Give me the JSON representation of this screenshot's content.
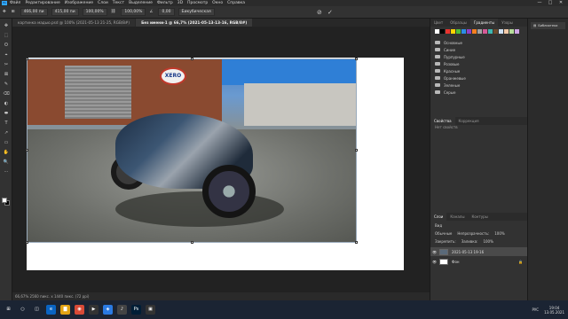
{
  "menubar": {
    "logo": "Ps",
    "items": [
      "Файл",
      "Редактирование",
      "Изображение",
      "Слои",
      "Текст",
      "Выделение",
      "Фильтр",
      "3D",
      "Просмотр",
      "Окно",
      "Справка"
    ],
    "window_controls": [
      "—",
      "□",
      "✕"
    ]
  },
  "options": {
    "x_value": "466,00 пи",
    "y_value": "415,00 пи",
    "w_value": "100,00%",
    "h_value": "100,00%",
    "angle": "0,00",
    "interp": "Бикубическая"
  },
  "tabs": [
    {
      "label": "картинка мадью.psd @ 100% (2021-05-13 21-25, RGB/8#)",
      "active": false
    },
    {
      "label": "Без имени-1 @ 66,7% (2021-05-13-13-16, RGB/8#)",
      "active": true
    }
  ],
  "tools": [
    "✥",
    "⬚",
    "ʘ",
    "⌖",
    "✂",
    "⊠",
    "✎",
    "⌫",
    "◐",
    "⬬",
    "T",
    "↗",
    "▭",
    "✋",
    "🔍",
    "⋯"
  ],
  "canvas": {
    "sign_text": "XERO"
  },
  "statusbar": {
    "text": "66,67%   2560 пикс. x 1440 пикс. (72 ppi)"
  },
  "right_panel": {
    "top_tabs": [
      {
        "label": "Цвет",
        "active": false
      },
      {
        "label": "Образцы",
        "active": false
      },
      {
        "label": "Градиенты",
        "active": true
      },
      {
        "label": "Узоры",
        "active": false
      }
    ],
    "swatch_colors": [
      "#ffffff",
      "#000000",
      "#e8342e",
      "#ffd400",
      "#4dbd38",
      "#2b8ee6",
      "#8f3fc8",
      "#f57f20",
      "#a3a3a3",
      "#d45a96",
      "#3fb7b0",
      "#6d4a2b",
      "#d0e2f5",
      "#f3c9a8",
      "#b6dd9a",
      "#cfa5e5"
    ],
    "folders": [
      "Основные",
      "Синие",
      "Пурпурные",
      "Розовые",
      "Красные",
      "Оранжевые",
      "Зеленые",
      "Серые"
    ],
    "props_tabs": [
      {
        "label": "Свойства",
        "active": true
      },
      {
        "label": "Коррекция",
        "active": false
      }
    ],
    "props_body": "Нет свойств",
    "layers_tabs": [
      {
        "label": "Слои",
        "active": true
      },
      {
        "label": "Каналы",
        "active": false
      },
      {
        "label": "Контуры",
        "active": false
      }
    ],
    "search_label": "Вид",
    "blend_mode": "Обычные",
    "opacity_label": "Непрозрачность:",
    "opacity_value": "100%",
    "lock_label": "Закрепить:",
    "fill_label": "Заливка:",
    "fill_value": "100%",
    "layers": [
      {
        "name": "2021-05-13 19-16",
        "selected": true,
        "thumb": "#5a6a7a"
      },
      {
        "name": "Фон",
        "selected": false,
        "thumb": "#ffffff"
      }
    ]
  },
  "right_dock": {
    "items": [
      "Библиотеки"
    ]
  },
  "taskbar": {
    "icons": [
      {
        "glyph": "⊞",
        "color": "#1b2433"
      },
      {
        "glyph": "○",
        "color": "#1b2433"
      },
      {
        "glyph": "◫",
        "color": "#1b2433"
      },
      {
        "glyph": "e",
        "color": "#0a64c2"
      },
      {
        "glyph": "▇",
        "color": "#e2a313"
      },
      {
        "glyph": "◉",
        "color": "#d84a36"
      },
      {
        "glyph": "▶",
        "color": "#333"
      },
      {
        "glyph": "◈",
        "color": "#2a7ae2"
      },
      {
        "glyph": "♪",
        "color": "#444"
      },
      {
        "glyph": "Ps",
        "color": "#001e36"
      },
      {
        "glyph": "▣",
        "color": "#333"
      }
    ],
    "language": "РУС",
    "time": "19:04",
    "date": "13.05.2021"
  }
}
